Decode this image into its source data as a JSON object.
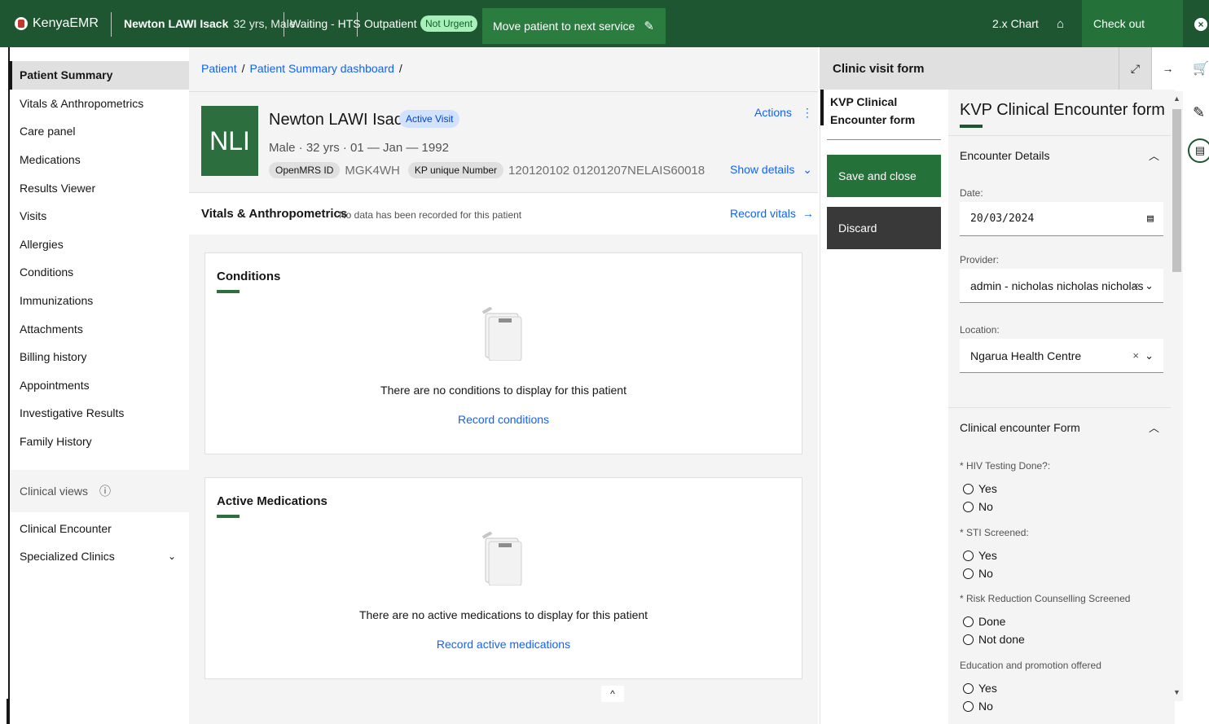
{
  "topbar": {
    "app_name": "KenyaEMR",
    "patient_name": "Newton LAWI Isack",
    "patient_info": "32 yrs, Male",
    "queue_status": "Waiting - HTS",
    "visit_type": "Outpatient",
    "priority": "Not Urgent",
    "move_label": "Move patient to next service",
    "chart_label": "2.x Chart",
    "checkout_label": "Check out",
    "colors": {
      "bar": "#1e5631",
      "accent": "#2a7d3e"
    }
  },
  "leftnav": {
    "items": [
      "Patient Summary",
      "Vitals & Anthropometrics",
      "Care panel",
      "Medications",
      "Results Viewer",
      "Visits",
      "Allergies",
      "Conditions",
      "Immunizations",
      "Attachments",
      "Billing history",
      "Appointments",
      "Investigative Results",
      "Family History"
    ],
    "section_label": "Clinical views",
    "section_items": [
      "Clinical Encounter",
      "Specialized Clinics"
    ]
  },
  "breadcrumb": {
    "items": [
      "Patient",
      "Patient Summary dashboard"
    ]
  },
  "patient": {
    "initials": "NLI",
    "name": "Newton LAWI Isack",
    "visit_badge": "Active Visit",
    "meta": "Male · 32 yrs · 01 — Jan — 1992",
    "openmrs_label": "OpenMRS ID",
    "openmrs_value": "MGK4WH",
    "kp_label": "KP unique Number",
    "kp_value": "120120102 01201207NELAIS60018",
    "actions_label": "Actions",
    "show_details_label": "Show details"
  },
  "vitals": {
    "title": "Vitals & Anthropometrics",
    "subtitle": "No data has been recorded for this patient",
    "record_label": "Record vitals"
  },
  "conditions_card": {
    "title": "Conditions",
    "empty_msg": "There are no conditions to display for this patient",
    "link": "Record conditions"
  },
  "medications_card": {
    "title": "Active Medications",
    "empty_msg": "There are no active medications to display for this patient",
    "link": "Record active medications"
  },
  "panel": {
    "title": "Clinic visit form",
    "form_nav_label": "KVP Clinical Encounter form",
    "save_label": "Save and close",
    "discard_label": "Discard",
    "form_title": "KVP Clinical Encounter form",
    "section1": "Encounter Details",
    "date_label": "Date:",
    "date_value": "20/03/2024",
    "provider_label": "Provider:",
    "provider_value": "admin - nicholas nicholas nicholas",
    "location_label": "Location:",
    "location_value": "Ngarua Health Centre",
    "section2": "Clinical encounter Form",
    "q1": "* HIV Testing Done?:",
    "q2": "* STI Screened:",
    "q3": "* Risk Reduction Counselling Screened",
    "q4": "Education and promotion offered",
    "yes": "Yes",
    "no": "No",
    "done": "Done",
    "not_done": "Not done"
  }
}
